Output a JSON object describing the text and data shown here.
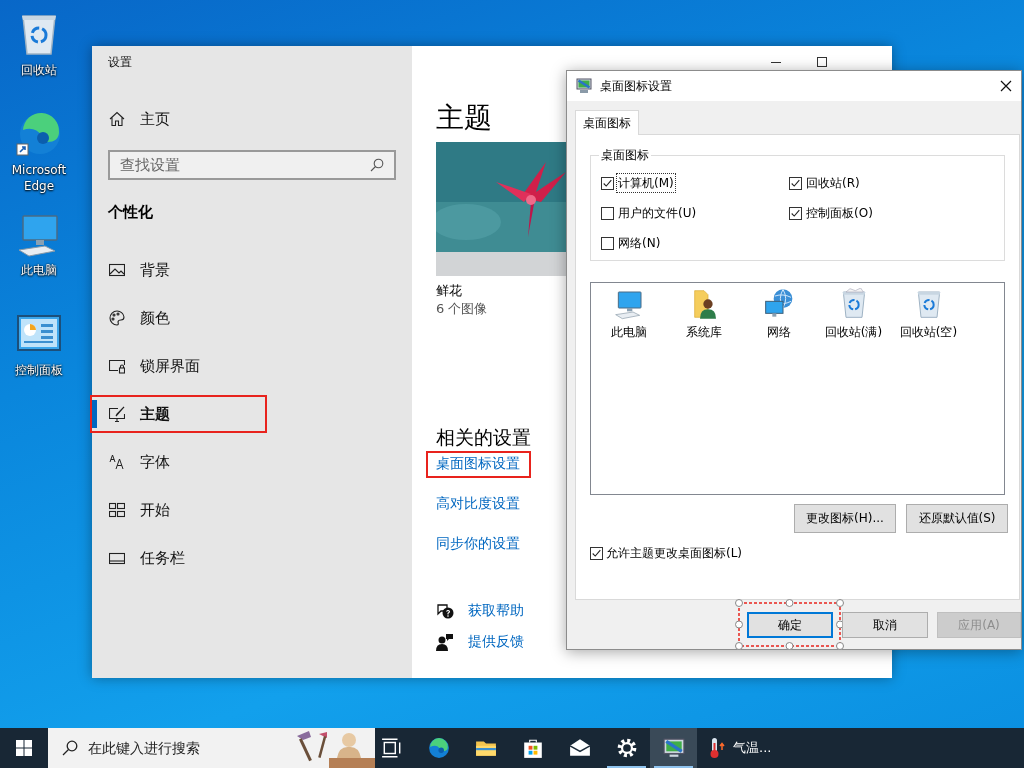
{
  "desktop_icons": [
    {
      "label": "回收站",
      "kind": "recycle"
    },
    {
      "label": "Microsoft Edge",
      "kind": "edge"
    },
    {
      "label": "此电脑",
      "kind": "pc"
    },
    {
      "label": "控制面板",
      "kind": "control"
    }
  ],
  "settings_window": {
    "title": "设置",
    "sidebar": {
      "home": "主页",
      "search": {
        "placeholder": "查找设置"
      },
      "section": "个性化",
      "items": [
        {
          "label": "背景",
          "kind": "background",
          "selected": false,
          "highlighted": false
        },
        {
          "label": "颜色",
          "kind": "color",
          "selected": false,
          "highlighted": false
        },
        {
          "label": "锁屏界面",
          "kind": "lockscreen",
          "selected": false,
          "highlighted": false
        },
        {
          "label": "主题",
          "kind": "theme",
          "selected": true,
          "highlighted": true
        },
        {
          "label": "字体",
          "kind": "font",
          "selected": false,
          "highlighted": false
        },
        {
          "label": "开始",
          "kind": "start",
          "selected": false,
          "highlighted": false
        },
        {
          "label": "任务栏",
          "kind": "taskbar",
          "selected": false,
          "highlighted": false
        }
      ]
    },
    "content": {
      "heading": "主题",
      "theme": {
        "kind": "picture",
        "name": "鲜花",
        "count": "6 个图像"
      },
      "related_heading": "相关的设置",
      "related_links": [
        {
          "label": "桌面图标设置",
          "highlighted": true
        },
        {
          "label": "高对比度设置",
          "highlighted": false
        },
        {
          "label": "同步你的设置",
          "highlighted": false
        }
      ],
      "help_links": [
        {
          "label": "获取帮助",
          "kind": "help"
        },
        {
          "label": "提供反馈",
          "kind": "feedback"
        }
      ]
    }
  },
  "dialog": {
    "title": "桌面图标设置",
    "tabs": [
      {
        "label": "桌面图标",
        "selected": true
      }
    ],
    "group": {
      "label": "桌面图标",
      "checkboxes": [
        {
          "label": "计算机(M)",
          "checked": true,
          "focused": true
        },
        {
          "label": "回收站(R)",
          "checked": true,
          "focused": false
        },
        {
          "label": "用户的文件(U)",
          "checked": false,
          "focused": false
        },
        {
          "label": "控制面板(O)",
          "checked": true,
          "focused": false
        },
        {
          "label": "网络(N)",
          "checked": false,
          "focused": false
        }
      ]
    },
    "icons": [
      {
        "label": "此电脑",
        "kind": "pc"
      },
      {
        "label": "系统库",
        "kind": "library"
      },
      {
        "label": "网络",
        "kind": "network"
      },
      {
        "label": "回收站(满)",
        "kind": "recycle-full"
      },
      {
        "label": "回收站(空)",
        "kind": "recycle-empty"
      }
    ],
    "icon_buttons": [
      "更改图标(H)...",
      "还原默认值(S)"
    ],
    "allow_themes": {
      "label": "允许主题更改桌面图标(L)",
      "checked": true
    },
    "buttons": [
      {
        "label": "确定",
        "default": true,
        "disabled": false,
        "highlighted": true
      },
      {
        "label": "取消",
        "default": false,
        "disabled": false,
        "highlighted": false
      },
      {
        "label": "应用(A)",
        "default": false,
        "disabled": true,
        "highlighted": false
      }
    ]
  },
  "taskbar": {
    "search": {
      "placeholder": "在此键入进行搜索"
    },
    "apps": [
      {
        "kind": "taskview",
        "running": false,
        "active": false
      },
      {
        "kind": "edge",
        "running": false,
        "active": false
      },
      {
        "kind": "explorer",
        "running": false,
        "active": false
      },
      {
        "kind": "store",
        "running": false,
        "active": false
      },
      {
        "kind": "mail",
        "running": false,
        "active": false
      },
      {
        "kind": "settings",
        "running": true,
        "active": false
      },
      {
        "kind": "desktop-icons",
        "running": true,
        "active": true
      }
    ],
    "weather": {
      "label": "气温..."
    }
  }
}
